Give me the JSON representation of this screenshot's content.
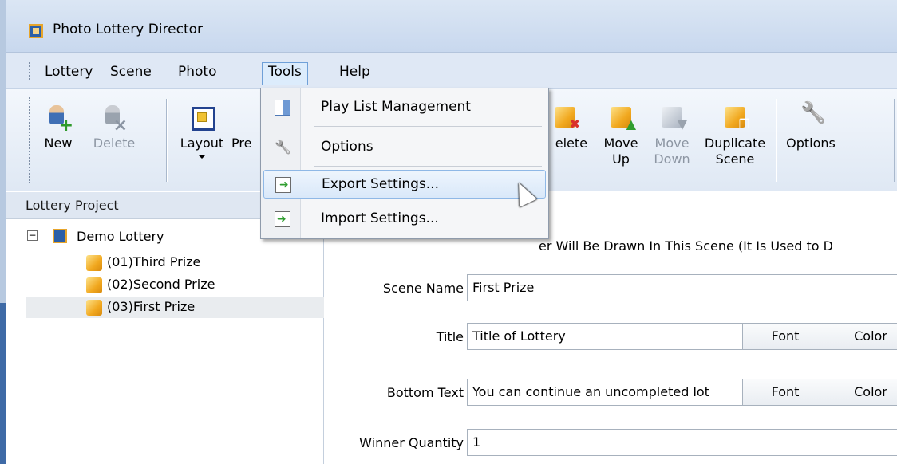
{
  "window": {
    "title": "Photo Lottery Director"
  },
  "menubar": {
    "items": [
      {
        "label": "Lottery"
      },
      {
        "label": "Scene"
      },
      {
        "label": "Photo"
      },
      {
        "label": "Tools",
        "active": true
      },
      {
        "label": "Help"
      }
    ]
  },
  "toolbar": {
    "new_label": "New",
    "delete_label": "Delete",
    "layout_label": "Layout",
    "preview_label": "Pre",
    "delete_scene_label": "elete",
    "move_up_label_1": "Move",
    "move_up_label_2": "Up",
    "move_down_label_1": "Move",
    "move_down_label_2": "Down",
    "duplicate_label_1": "Duplicate",
    "duplicate_label_2": "Scene",
    "options_label": "Options"
  },
  "tools_menu": {
    "items": [
      {
        "label": "Play List Management",
        "icon": "playlist-icon"
      },
      {
        "label": "Options",
        "icon": "wrench-icon"
      },
      {
        "label": "Export Settings...",
        "icon": "export-icon",
        "highlighted": true
      },
      {
        "label": "Import Settings...",
        "icon": "import-icon"
      }
    ]
  },
  "left_panel": {
    "header": "Lottery Project",
    "root": {
      "label": "Demo Lottery",
      "expander": "−"
    },
    "scenes": [
      {
        "label": "(01)Third Prize"
      },
      {
        "label": "(02)Second Prize"
      },
      {
        "label": "(03)First Prize",
        "selected": true
      }
    ]
  },
  "form": {
    "hint": "er Will Be Drawn In This Scene  (It Is Used to D",
    "scene_name_label": "Scene Name",
    "scene_name_value": "First Prize",
    "title_label": "Title",
    "title_value": "Title of Lottery",
    "bottom_text_label": "Bottom Text",
    "bottom_text_value": "You can continue an uncompleted lot",
    "winner_quantity_label": "Winner Quantity",
    "winner_quantity_value": "1",
    "font_button": "Font",
    "color_button": "Color"
  },
  "colors": {
    "titlebar": "#c8d8ee",
    "menubar": "#dfe8f5",
    "menu_highlight": "#d9e8f9",
    "selection": "#e9ecef"
  }
}
